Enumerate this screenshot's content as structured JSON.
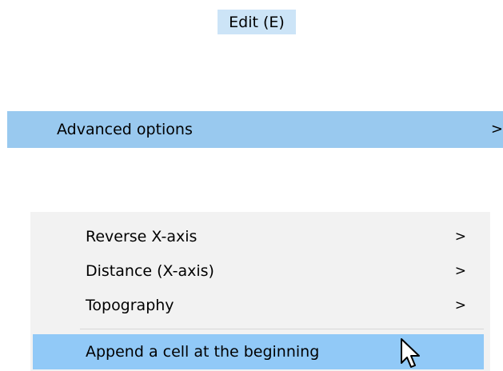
{
  "menubar": {
    "edit_label": "Edit (E)"
  },
  "main_menu": {
    "advanced_label": "Advanced options",
    "advanced_arrow": ">"
  },
  "submenu": {
    "items": [
      {
        "label": "Reverse X-axis",
        "arrow": ">"
      },
      {
        "label": "Distance (X-axis)",
        "arrow": ">"
      },
      {
        "label": "Topography",
        "arrow": ">"
      },
      {
        "label": "Append a cell at the beginning"
      }
    ]
  },
  "colors": {
    "menubar_highlight": "#cce4f7",
    "advanced_highlight": "#99c9ef",
    "submenu_background": "#f2f2f2",
    "item_hover": "#91c9f7"
  },
  "icons": {
    "cursor": "mouse-pointer-icon"
  }
}
